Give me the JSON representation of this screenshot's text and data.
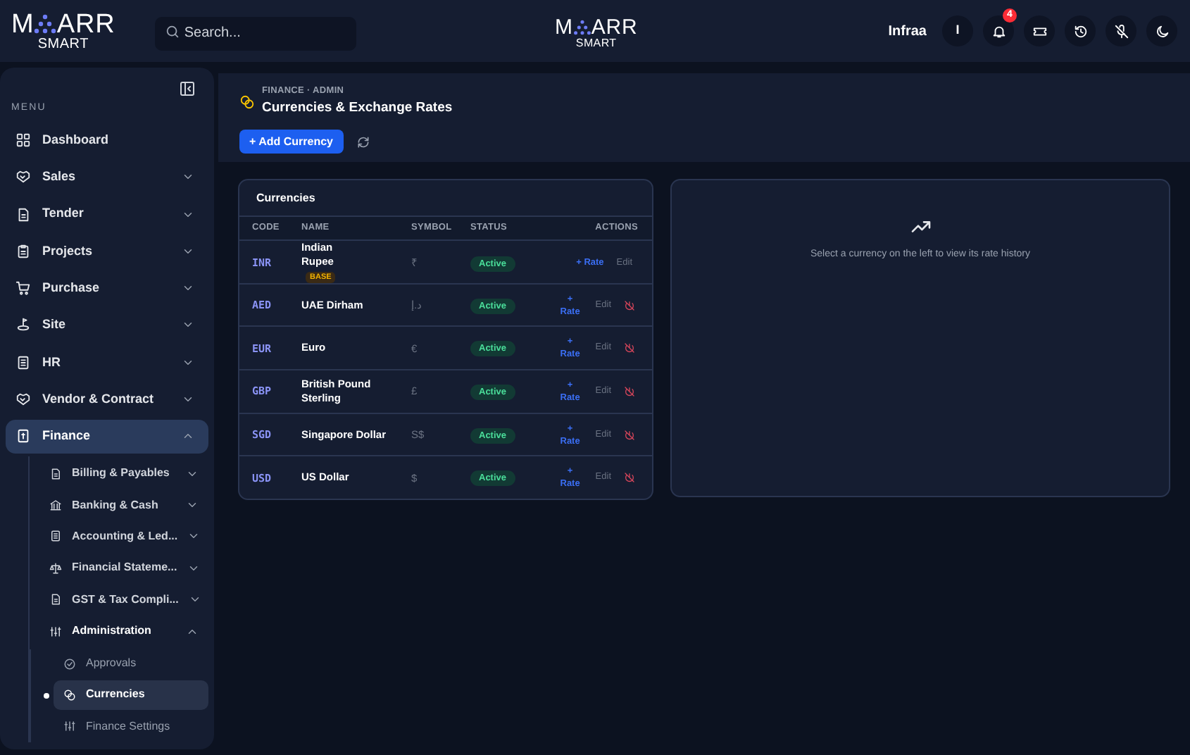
{
  "topbar": {
    "logo": {
      "left": "M",
      "right": "ARR",
      "sub": "SMART"
    },
    "search": {
      "placeholder": "Search..."
    },
    "center_logo": {
      "left": "M",
      "right": "ARR",
      "sub": "SMART"
    },
    "user": "Infraa",
    "avatar": "I",
    "notifications": "4"
  },
  "sidebar": {
    "heading": "MENU",
    "items": [
      {
        "label": "Dashboard",
        "expandable": false,
        "selected": false
      },
      {
        "label": "Sales",
        "expandable": true,
        "expanded": false,
        "selected": false
      },
      {
        "label": "Tender",
        "expandable": true,
        "expanded": false,
        "selected": false
      },
      {
        "label": "Projects",
        "expandable": true,
        "expanded": false,
        "selected": false
      },
      {
        "label": "Purchase",
        "expandable": true,
        "expanded": false,
        "selected": false
      },
      {
        "label": "Site",
        "expandable": true,
        "expanded": false,
        "selected": false
      },
      {
        "label": "HR",
        "expandable": true,
        "expanded": false,
        "selected": false
      },
      {
        "label": "Vendor & Contract",
        "expandable": true,
        "expanded": false,
        "selected": false
      },
      {
        "label": "Finance",
        "expandable": true,
        "expanded": true,
        "selected": true,
        "children": [
          {
            "label": "Billing & Payables",
            "expanded": false
          },
          {
            "label": "Banking & Cash",
            "expanded": false
          },
          {
            "label": "Accounting & Led...",
            "expanded": false
          },
          {
            "label": "Financial Stateme...",
            "expanded": false
          },
          {
            "label": "GST & Tax Compli...",
            "expanded": false
          },
          {
            "label": "Administration",
            "expanded": true,
            "children": [
              {
                "label": "Approvals",
                "selected": false
              },
              {
                "label": "Currencies",
                "selected": true
              },
              {
                "label": "Finance Settings",
                "selected": false
              }
            ]
          }
        ]
      }
    ]
  },
  "header": {
    "breadcrumb": "FINANCE · ADMIN",
    "title": "Currencies & Exchange Rates",
    "add_button": "+ Add Currency"
  },
  "table": {
    "title": "Currencies",
    "columns": [
      "CODE",
      "NAME",
      "SYMBOL",
      "STATUS",
      "ACTIONS"
    ],
    "rows": [
      {
        "code": "INR",
        "name": "Indian Rupee",
        "base": true,
        "badge": "BASE",
        "symbol": "₹",
        "status": "Active",
        "rate": "+ Rate",
        "edit": "Edit",
        "deletable": false
      },
      {
        "code": "AED",
        "name": "UAE Dirham",
        "base": false,
        "symbol": "د.إ",
        "status": "Active",
        "rate": "+ Rate",
        "edit": "Edit",
        "deletable": true
      },
      {
        "code": "EUR",
        "name": "Euro",
        "base": false,
        "symbol": "€",
        "status": "Active",
        "rate": "+ Rate",
        "edit": "Edit",
        "deletable": true
      },
      {
        "code": "GBP",
        "name": "British Pound Sterling",
        "base": false,
        "symbol": "£",
        "status": "Active",
        "rate": "+ Rate",
        "edit": "Edit",
        "deletable": true
      },
      {
        "code": "SGD",
        "name": "Singapore Dollar",
        "base": false,
        "symbol": "S$",
        "status": "Active",
        "rate": "+ Rate",
        "edit": "Edit",
        "deletable": true
      },
      {
        "code": "USD",
        "name": "US Dollar",
        "base": false,
        "symbol": "$",
        "status": "Active",
        "rate": "+ Rate",
        "edit": "Edit",
        "deletable": true
      }
    ]
  },
  "history": {
    "message": "Select a currency on the left to view its rate history"
  }
}
